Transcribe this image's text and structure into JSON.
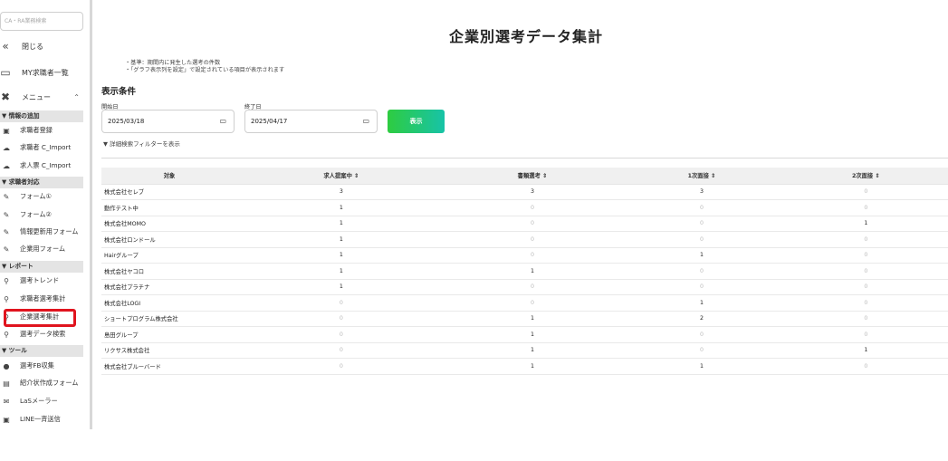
{
  "sidebar": {
    "search_placeholder": "CA・RA業務検索",
    "close_label": "閉じる",
    "my_seekers_label": "MY求職者一覧",
    "menu_label": "メニュー",
    "sections": [
      {
        "title": "▼ 情報の追加",
        "items": [
          "求職者登録",
          "求職者 C_Import",
          "求人票 C_Import"
        ]
      },
      {
        "title": "▼ 求職者対応",
        "items": [
          "フォーム①",
          "フォーム②",
          "情報更新用フォーム",
          "企業用フォーム"
        ]
      },
      {
        "title": "▼ レポート",
        "items": [
          "選考トレンド",
          "求職者選考集計",
          "企業選考集計",
          "選考データ検索"
        ]
      },
      {
        "title": "▼ ツール",
        "items": [
          "選考FB収集",
          "紹介状作成フォーム",
          "LaSメーラー",
          "LINE一斉送信"
        ]
      }
    ]
  },
  "main": {
    "title": "企業別選考データ集計",
    "notes": [
      "・基準：期間内に発生した選考の件数",
      "・「グラフ表示列を設定」で設定されている項目が表示されます"
    ],
    "conditions_title": "表示条件",
    "start_label": "開始日",
    "start_value": "2025/03/18",
    "end_label": "終了日",
    "end_value": "2025/04/17",
    "show_button": "表示",
    "filter_toggle": "▼ 詳細検索フィルターを表示"
  },
  "table": {
    "headers": [
      "対象",
      "求人提案中 ⇕",
      "書類選考 ⇕",
      "1次面接 ⇕",
      "2次面接 ⇕"
    ],
    "rows": [
      [
        "株式会社セレブ",
        "3",
        "3",
        "3",
        "0"
      ],
      [
        "動作テスト中",
        "1",
        "0",
        "0",
        "0"
      ],
      [
        "株式会社MOMO",
        "1",
        "0",
        "0",
        "1"
      ],
      [
        "株式会社ロンドール",
        "1",
        "0",
        "0",
        "0"
      ],
      [
        "Hairグループ",
        "1",
        "0",
        "1",
        "0"
      ],
      [
        "株式会社ヤコロ",
        "1",
        "1",
        "0",
        "0"
      ],
      [
        "株式会社プラチナ",
        "1",
        "0",
        "0",
        "0"
      ],
      [
        "株式会社LOGI",
        "0",
        "0",
        "1",
        "0"
      ],
      [
        "ショートプログラム株式会社",
        "0",
        "1",
        "2",
        "0"
      ],
      [
        "島田グループ",
        "0",
        "1",
        "0",
        "0"
      ],
      [
        "リクサス株式会社",
        "0",
        "1",
        "0",
        "1"
      ],
      [
        "株式会社ブルーバード",
        "0",
        "1",
        "1",
        "0"
      ]
    ]
  },
  "colors": {
    "highlight": "#e0141e",
    "button_start": "#2ecc40",
    "button_end": "#17c3a8"
  }
}
